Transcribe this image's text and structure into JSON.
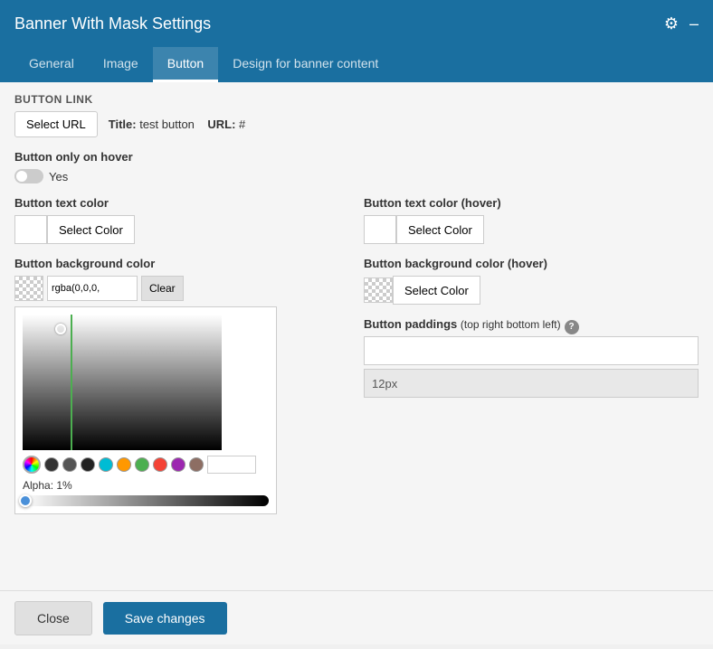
{
  "header": {
    "title": "Banner With Mask Settings",
    "gear_icon": "⚙",
    "minimize_icon": "–"
  },
  "tabs": [
    {
      "label": "General",
      "active": false
    },
    {
      "label": "Image",
      "active": false
    },
    {
      "label": "Button",
      "active": true
    },
    {
      "label": "Design for banner content",
      "active": false
    }
  ],
  "button_link": {
    "section_label": "Button link",
    "select_url_label": "Select URL",
    "title_label": "Title:",
    "title_value": "test button",
    "url_label": "URL:",
    "url_value": "#"
  },
  "button_hover": {
    "label": "Button only on hover",
    "toggle_label": "Yes"
  },
  "button_text_color": {
    "label": "Button text color",
    "select_label": "Select Color"
  },
  "button_text_color_hover": {
    "label": "Button text color (hover)",
    "select_label": "Select Color"
  },
  "button_bg_color": {
    "label": "Button background color",
    "rgba_value": "rgba(0,0,0,",
    "clear_label": "Clear"
  },
  "button_bg_color_hover": {
    "label": "Button background color (hover)",
    "select_label": "Select Color"
  },
  "button_paddings": {
    "label": "Button paddings",
    "sublabel": "(top right bottom left)",
    "value": "12px"
  },
  "color_picker": {
    "alpha_label": "Alpha: 1%"
  },
  "preset_colors": [
    "#000000",
    "#333333",
    "#666666",
    "#1a1a1a",
    "#00bcd4",
    "#ff9800",
    "#4caf50",
    "#f44336",
    "#9c27b0",
    "#8d6e63"
  ],
  "footer": {
    "close_label": "Close",
    "save_label": "Save changes"
  }
}
